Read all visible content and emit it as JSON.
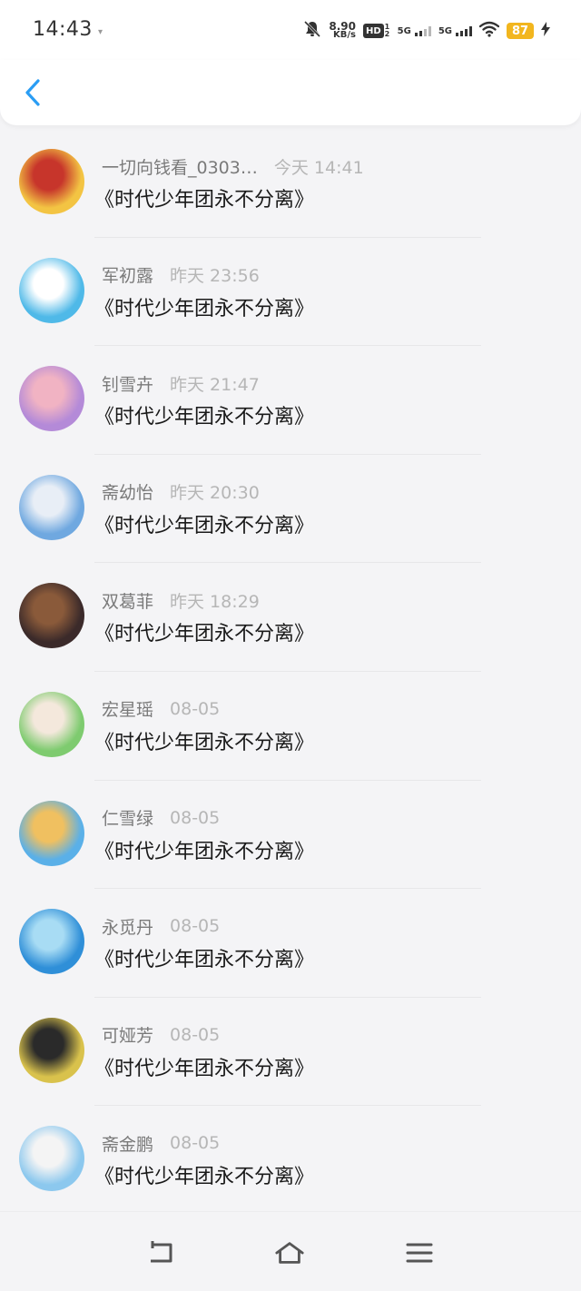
{
  "status_bar": {
    "time": "14:43",
    "net_speed_value": "8.90",
    "net_speed_unit": "KB/s",
    "hd_label": "HD",
    "hd_sub": "1 2",
    "sim1_label": "5G",
    "sim2_label": "5G",
    "battery": "87",
    "icons": [
      "mute-bell-icon",
      "wifi-icon",
      "charging-icon"
    ]
  },
  "header": {
    "back_icon": "chevron-left-icon"
  },
  "messages": [
    {
      "name": "一切向钱看_0303…",
      "time": "今天 14:41",
      "text": "《时代少年团永不分离》",
      "avatar_colors": [
        "#f3c443",
        "#c7352b"
      ]
    },
    {
      "name": "军初露",
      "time": "昨天 23:56",
      "text": "《时代少年团永不分离》",
      "avatar_colors": [
        "#4fb9e8",
        "#ffffff"
      ]
    },
    {
      "name": "钊雪卉",
      "time": "昨天 21:47",
      "text": "《时代少年团永不分离》",
      "avatar_colors": [
        "#b48ad8",
        "#f1b3c3"
      ]
    },
    {
      "name": "斋幼怡",
      "time": "昨天 20:30",
      "text": "《时代少年团永不分离》",
      "avatar_colors": [
        "#6fa8e0",
        "#e8eef6"
      ]
    },
    {
      "name": "双葛菲",
      "time": "昨天 18:29",
      "text": "《时代少年团永不分离》",
      "avatar_colors": [
        "#3b2a2a",
        "#8a5a3a"
      ]
    },
    {
      "name": "宏星瑶",
      "time": "08-05",
      "text": "《时代少年团永不分离》",
      "avatar_colors": [
        "#7ecb6f",
        "#f4e8dc"
      ]
    },
    {
      "name": "仁雪绿",
      "time": "08-05",
      "text": "《时代少年团永不分离》",
      "avatar_colors": [
        "#5ab0e8",
        "#f0c060"
      ]
    },
    {
      "name": "永觅丹",
      "time": "08-05",
      "text": "《时代少年团永不分离》",
      "avatar_colors": [
        "#2f8fd8",
        "#a8dcf4"
      ]
    },
    {
      "name": "可娅芳",
      "time": "08-05",
      "text": "《时代少年团永不分离》",
      "avatar_colors": [
        "#d9c24c",
        "#2a2a2a"
      ]
    },
    {
      "name": "斋金鹏",
      "time": "08-05",
      "text": "《时代少年团永不分离》",
      "avatar_colors": [
        "#8cc8ee",
        "#f4f4f4"
      ]
    }
  ],
  "navbar": {
    "items": [
      "back-gesture-icon",
      "home-icon",
      "menu-icon"
    ]
  },
  "colors": {
    "accent": "#2a9df4",
    "battery": "#f2b61e"
  }
}
